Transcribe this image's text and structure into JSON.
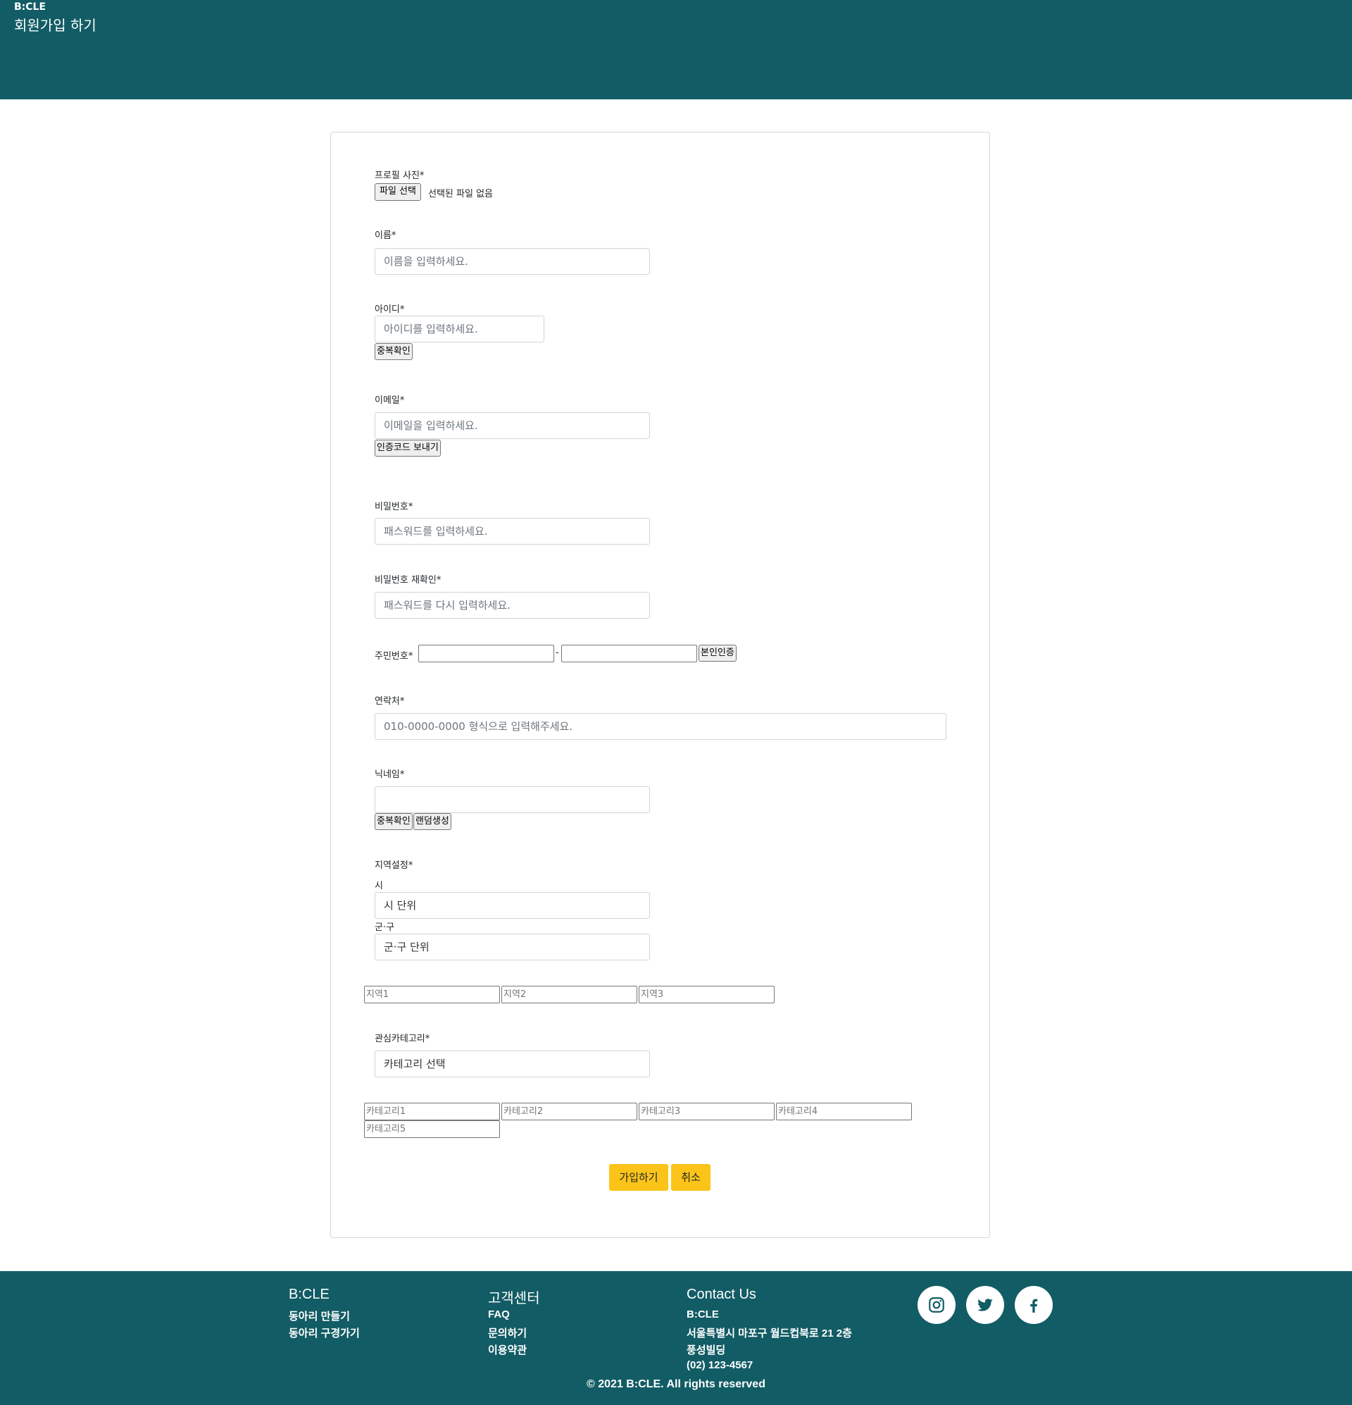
{
  "header": {
    "brand": "B:CLE",
    "title": "회원가입 하기"
  },
  "form": {
    "profile": {
      "label": "프로필 사진*",
      "file_button": "파일 선택",
      "file_status": "선택된 파일 없음"
    },
    "name": {
      "label": "이름*",
      "placeholder": "이름을 입력하세요."
    },
    "userid": {
      "label": "아이디*",
      "placeholder": "아이디를 입력하세요.",
      "check_button": "중복확인"
    },
    "email": {
      "label": "이메일*",
      "placeholder": "이메일을 입력하세요.",
      "send_button": "인증코드 보내기"
    },
    "password": {
      "label": "비밀번호*",
      "placeholder": "패스워드를 입력하세요."
    },
    "password_confirm": {
      "label": "비밀번호 재확인*",
      "placeholder": "패스워드를 다시 입력하세요."
    },
    "ssn": {
      "label": "주민번호*",
      "separator": "-",
      "verify_button": "본인인증"
    },
    "phone": {
      "label": "연락처*",
      "placeholder": "010-0000-0000 형식으로 입력해주세요."
    },
    "nickname": {
      "label": "닉네임*",
      "placeholder": "",
      "check_button": "중복확인",
      "random_button": "랜덤생성"
    },
    "region": {
      "label": "지역설정*",
      "city_label": "시",
      "city_value": "시 단위",
      "district_label": "군·구",
      "district_value": "군·구 단위",
      "slots": [
        "지역1",
        "지역2",
        "지역3"
      ]
    },
    "category": {
      "label": "관심카테고리*",
      "select_value": "카테고리 선택",
      "slots": [
        "카테고리1",
        "카테고리2",
        "카테고리3",
        "카테고리4",
        "카테고리5"
      ]
    },
    "submit_button": "가입하기",
    "cancel_button": "취소"
  },
  "footer": {
    "col1": {
      "title": "B:CLE",
      "items": [
        "동아리 만들기",
        "동아리 구경가기"
      ]
    },
    "col2": {
      "title": "고객센터",
      "items": [
        "FAQ",
        "문의하기",
        "이용약관"
      ]
    },
    "col3": {
      "title": "Contact Us",
      "items": [
        "B:CLE",
        "서울특별시 마포구 월드컵북로 21 2층",
        "풍성빌딩",
        "(02) 123-4567"
      ]
    },
    "social": [
      "instagram-icon",
      "twitter-icon",
      "facebook-icon"
    ],
    "copyright": "© 2021 B:CLE. All rights reserved"
  },
  "colors": {
    "brand": "#125c65",
    "accent": "#fcc419"
  }
}
